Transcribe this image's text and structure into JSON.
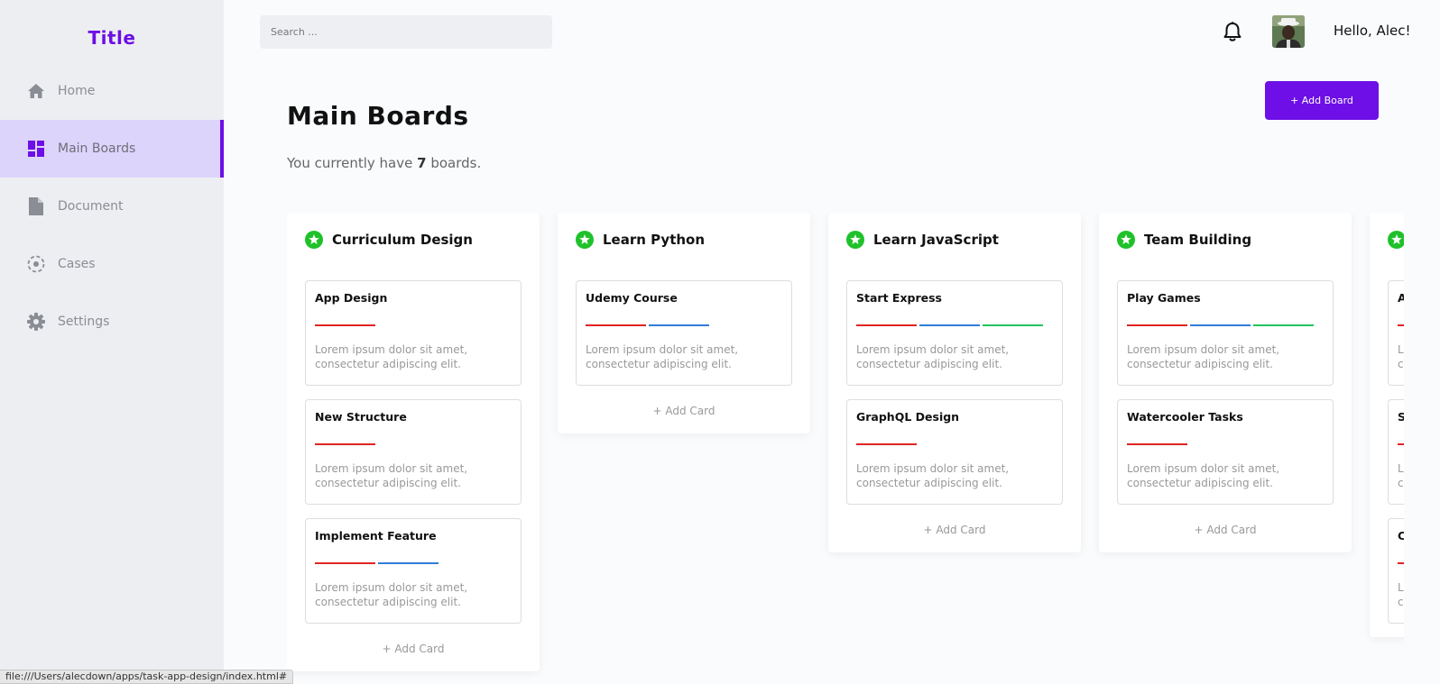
{
  "sidebar": {
    "brand": "Title",
    "items": [
      {
        "label": "Home",
        "icon": "home-icon"
      },
      {
        "label": "Main Boards",
        "icon": "dashboard-icon",
        "active": true
      },
      {
        "label": "Document",
        "icon": "document-icon"
      },
      {
        "label": "Cases",
        "icon": "cases-icon"
      },
      {
        "label": "Settings",
        "icon": "gear-icon"
      }
    ]
  },
  "topbar": {
    "search_placeholder": "Search ...",
    "greeting": "Hello, Alec!"
  },
  "header": {
    "title": "Main Boards",
    "subtitle_prefix": "You currently have ",
    "board_count": "7",
    "subtitle_suffix": " boards.",
    "add_board_label": "+ Add Board"
  },
  "colors": {
    "accent": "#6d0fe6",
    "star": "#1fc12a",
    "tag_red": "#e02424",
    "tag_blue": "#2f7dd6",
    "tag_green": "#22c55e"
  },
  "card_text": "Lorem ipsum dolor sit amet, consectetur adipiscing elit.",
  "add_card_label": "+ Add Card",
  "boards": [
    {
      "title": "Curriculum Design",
      "cards": [
        {
          "title": "App Design",
          "tags": [
            "red"
          ]
        },
        {
          "title": "New Structure",
          "tags": [
            "red"
          ]
        },
        {
          "title": "Implement Feature",
          "tags": [
            "red",
            "blue"
          ]
        }
      ]
    },
    {
      "title": "Learn Python",
      "cards": [
        {
          "title": "Udemy Course",
          "tags": [
            "red",
            "blue"
          ]
        }
      ]
    },
    {
      "title": "Learn JavaScript",
      "cards": [
        {
          "title": "Start Express",
          "tags": [
            "red",
            "blue",
            "green"
          ]
        },
        {
          "title": "GraphQL Design",
          "tags": [
            "red"
          ]
        }
      ]
    },
    {
      "title": "Team Building",
      "cards": [
        {
          "title": "Play Games",
          "tags": [
            "red",
            "blue",
            "green"
          ]
        },
        {
          "title": "Watercooler Tasks",
          "tags": [
            "red"
          ]
        }
      ]
    },
    {
      "title": "",
      "cards": [
        {
          "title": "A",
          "tags": [
            "red"
          ]
        },
        {
          "title": "S",
          "tags": [
            "red"
          ]
        },
        {
          "title": "C",
          "tags": [
            "red"
          ]
        }
      ]
    }
  ],
  "statusbar": "file:///Users/alecdown/apps/task-app-design/index.html#"
}
